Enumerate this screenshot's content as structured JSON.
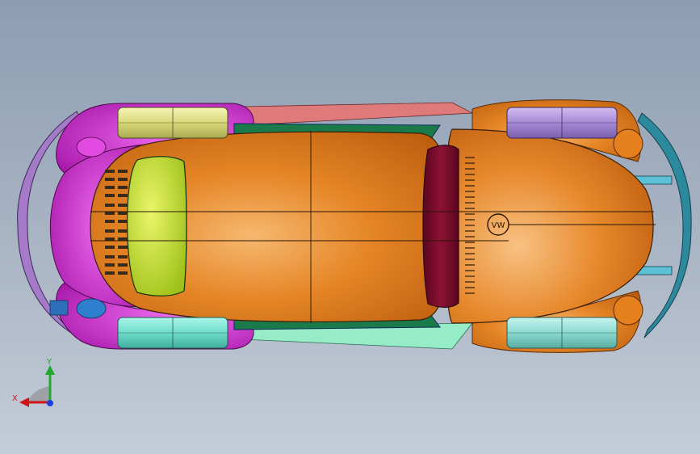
{
  "viewport": {
    "background_top": "#8d9db2",
    "background_bottom": "#c4ccd7"
  },
  "model": {
    "badge_text": "VW",
    "colors": {
      "body": "#e07a18",
      "body_highlight": "#f4b26a",
      "fenders_rear": "#d81fd6",
      "rear_window": "#c9e62e",
      "windshield": "#7a0b2a",
      "wheel_front_left": "#a98bd8",
      "wheel_front_right": "#7fe2d6",
      "wheel_rear_left": "#e5e59a",
      "wheel_rear_right": "#5fe8c6",
      "bumper_front": "#2a8ba0",
      "bumper_rear": "#9b6bbf",
      "running_board_left": "#d86b6b",
      "running_board_right": "#8fe8c0"
    }
  },
  "triad": {
    "x_label": "X",
    "y_label": "Y",
    "x_color": "#d0141a",
    "y_color": "#20a830",
    "z_color": "#1f3fd8"
  }
}
